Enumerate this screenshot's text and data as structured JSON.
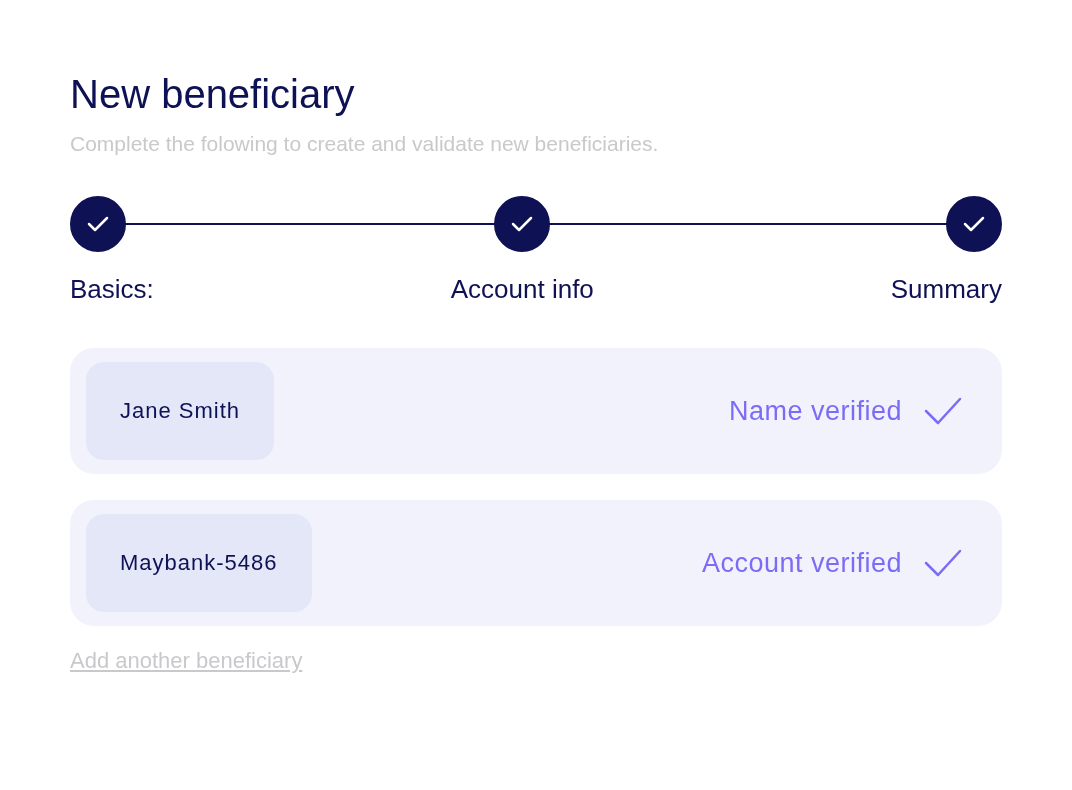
{
  "title": "New beneficiary",
  "subtitle": "Complete the folowing to create and validate new beneficiaries.",
  "steps": [
    {
      "label": "Basics:",
      "completed": true
    },
    {
      "label": "Account info",
      "completed": true
    },
    {
      "label": "Summary",
      "completed": true
    }
  ],
  "entries": [
    {
      "value": "Jane Smith",
      "status": "Name verified",
      "verified": true
    },
    {
      "value": "Maybank-5486",
      "status": "Account verified",
      "verified": true
    }
  ],
  "link": "Add another beneficiary"
}
